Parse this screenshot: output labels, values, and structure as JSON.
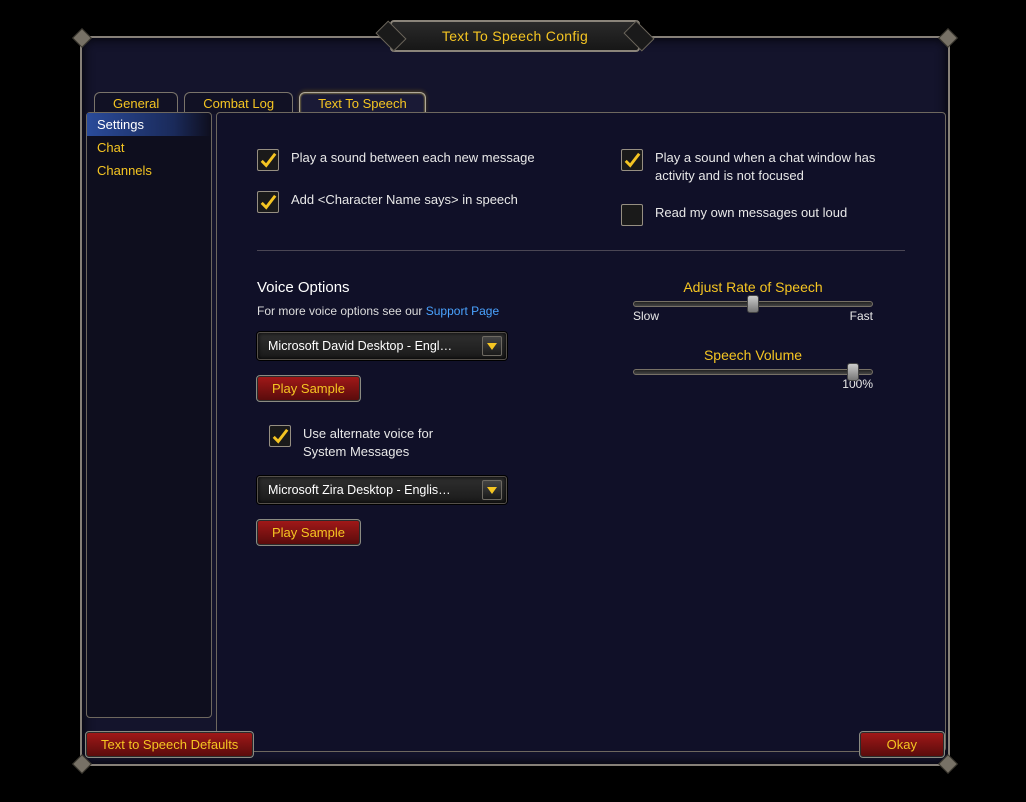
{
  "title": "Text To Speech Config",
  "tabs": [
    {
      "label": "General",
      "active": false
    },
    {
      "label": "Combat Log",
      "active": false
    },
    {
      "label": "Text To Speech",
      "active": true
    }
  ],
  "sidebar": {
    "items": [
      {
        "label": "Settings",
        "selected": true
      },
      {
        "label": "Chat",
        "selected": false
      },
      {
        "label": "Channels",
        "selected": false
      }
    ]
  },
  "checks": {
    "leftCol": [
      {
        "label": "Play a sound between each new message",
        "checked": true
      },
      {
        "label": "Add <Character Name says> in speech",
        "checked": true
      }
    ],
    "rightCol": [
      {
        "label": "Play a sound when a chat window has activity and is not focused",
        "checked": true
      },
      {
        "label": "Read my own messages out loud",
        "checked": false
      }
    ]
  },
  "voice": {
    "title": "Voice Options",
    "helpPrefix": "For more voice options see our ",
    "helpLink": "Support Page",
    "dropdown1": "Microsoft David Desktop - Engl…",
    "playSample": "Play Sample",
    "altVoiceLabel": "Use alternate voice for System Messages",
    "altVoiceChecked": true,
    "dropdown2": "Microsoft Zira Desktop - Englis…"
  },
  "sliders": {
    "rate": {
      "title": "Adjust Rate of Speech",
      "left": "Slow",
      "right": "Fast",
      "pos": 50
    },
    "volume": {
      "title": "Speech Volume",
      "value": "100%",
      "pos": 92
    }
  },
  "footer": {
    "defaults": "Text to Speech Defaults",
    "okay": "Okay"
  }
}
